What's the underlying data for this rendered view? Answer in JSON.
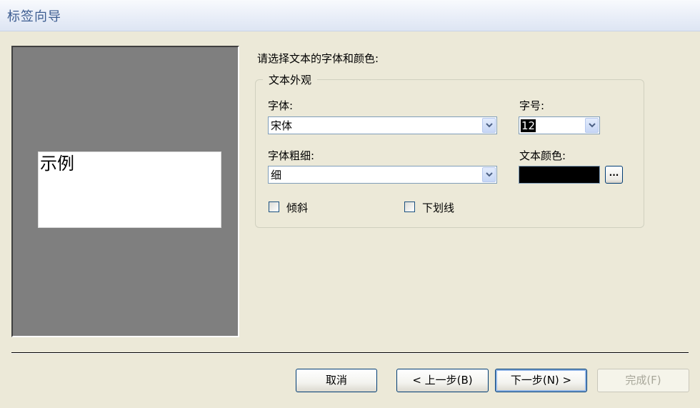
{
  "window": {
    "title": "标签向导"
  },
  "preview": {
    "sample_text": "示例"
  },
  "form": {
    "prompt": "请选择文本的字体和颜色:",
    "group_title": "文本外观",
    "font_label": "字体:",
    "font_value": "宋体",
    "size_label": "字号:",
    "size_value": "12",
    "weight_label": "字体粗细:",
    "weight_value": "细",
    "color_label": "文本颜色:",
    "color_value": "#000000",
    "color_button_label": "...",
    "italic_label": "倾斜",
    "italic_checked": false,
    "underline_label": "下划线",
    "underline_checked": false
  },
  "buttons": {
    "cancel": "取消",
    "back": "< 上一步(B)",
    "next": "下一步(N) >",
    "finish": "完成(F)",
    "finish_enabled": false
  },
  "icons": {
    "dropdown": "chevron-down-icon"
  },
  "colors": {
    "title_text": "#3d5d91",
    "dialog_bg": "#ece9d8",
    "preview_bg": "#7f7f7f",
    "button_border": "#003c74"
  }
}
